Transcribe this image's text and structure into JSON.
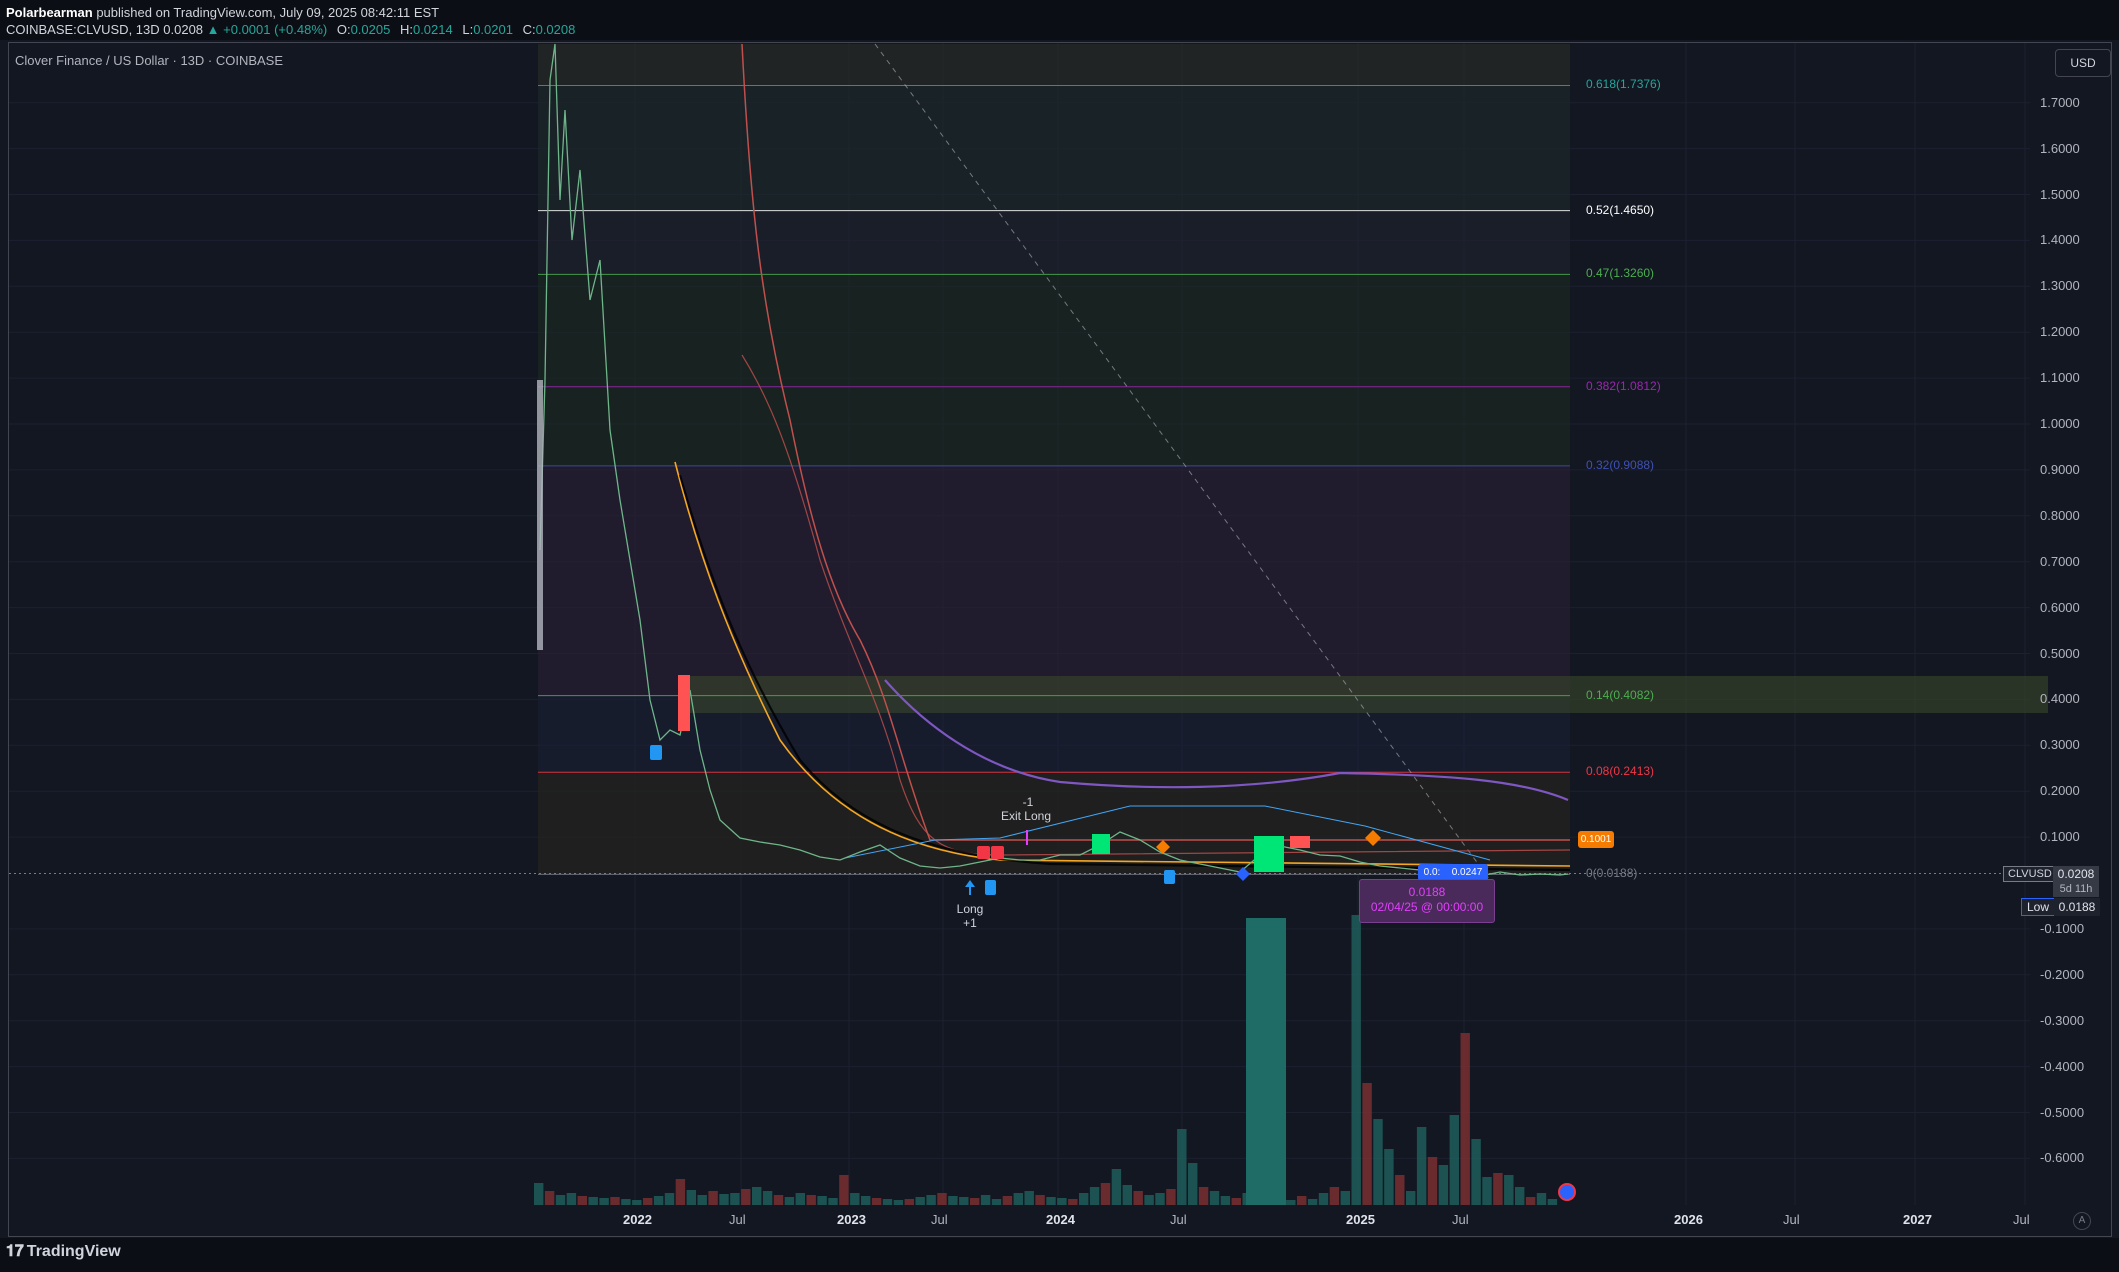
{
  "header": {
    "author": "Polarbearman",
    "publish_suffix": "published on TradingView.com, July 09, 2025 08:42:11 EST",
    "ohlc_symbol": "COINBASE:CLVUSD, 13D",
    "last": "0.0208",
    "change": "▲ +0.0001 (+0.48%)",
    "o_key": "O:",
    "o_val": "0.0205",
    "h_key": "H:",
    "h_val": "0.0214",
    "l_key": "L:",
    "l_val": "0.0201",
    "c_key": "C:",
    "c_val": "0.0208"
  },
  "chart": {
    "title": "Clover Finance / US Dollar · 13D · COINBASE",
    "currency_button": "USD",
    "y_ticks": [
      "1.7000",
      "1.6000",
      "1.5000",
      "1.4000",
      "1.3000",
      "1.2000",
      "1.1000",
      "1.0000",
      "0.9000",
      "0.8000",
      "0.7000",
      "0.6000",
      "0.5000",
      "0.4000",
      "0.3000",
      "0.2000",
      "0.1000",
      "-0.1000",
      "-0.2000",
      "-0.3000",
      "-0.4000",
      "-0.5000",
      "-0.6000"
    ],
    "x_ticks": [
      {
        "label": "2022",
        "strong": true
      },
      {
        "label": "Jul",
        "strong": false
      },
      {
        "label": "2023",
        "strong": true
      },
      {
        "label": "Jul",
        "strong": false
      },
      {
        "label": "2024",
        "strong": true
      },
      {
        "label": "Jul",
        "strong": false
      },
      {
        "label": "2025",
        "strong": true
      },
      {
        "label": "Jul",
        "strong": false
      },
      {
        "label": "2026",
        "strong": true
      },
      {
        "label": "Jul",
        "strong": false
      },
      {
        "label": "2027",
        "strong": true
      },
      {
        "label": "Jul",
        "strong": false
      }
    ],
    "fib_levels": [
      {
        "label": "0.618(1.7376)",
        "color": "#26a69a"
      },
      {
        "label": "0.52(1.4650)",
        "color": "#ffffff"
      },
      {
        "label": "0.47(1.3260)",
        "color": "#4caf50"
      },
      {
        "label": "0.382(1.0812)",
        "color": "#9c27b0"
      },
      {
        "label": "0.32(0.9088)",
        "color": "#3f51b5"
      },
      {
        "label": "0.14(0.4082)",
        "color": "#4caf50"
      },
      {
        "label": "0.08(0.2413)",
        "color": "#f23645"
      },
      {
        "label": "0(0.0188)",
        "color": "#787b86"
      }
    ],
    "annotations": {
      "exit_count": "-1",
      "exit_label": "Exit Long",
      "long_label": "Long",
      "long_count": "+1"
    },
    "tags": {
      "orange_price": "0.1001",
      "blue_a": "0.0:",
      "blue_b": "0.0247",
      "symbol": "CLVUSD",
      "last_price": "0.0208",
      "countdown": "5d 11h",
      "low_label": "Low",
      "low_value": "0.0188"
    },
    "tooltip": {
      "value": "0.0188",
      "date": "02/04/25 @ 00:00:00"
    }
  },
  "footer": {
    "brand_mark": "𝟏𝟕",
    "brand": "TradingView",
    "scale_button": "A"
  },
  "colors": {
    "background": "#131722",
    "up": "#26a69a",
    "down": "#ef5350",
    "accent": "#2962ff",
    "orange": "#f57c00"
  },
  "chart_data": {
    "type": "line",
    "title": "Clover Finance / US Dollar · 13D · COINBASE",
    "xlabel": "",
    "ylabel": "",
    "ylim": [
      -0.7,
      1.8
    ],
    "y_scale": "linear",
    "grid": true,
    "x": [
      "2021-08",
      "2021-09",
      "2021-10",
      "2021-11",
      "2021-12",
      "2022-01",
      "2022-03",
      "2022-05",
      "2022-07",
      "2022-10",
      "2023-01",
      "2023-04",
      "2023-07",
      "2023-10",
      "2024-01",
      "2024-04",
      "2024-07",
      "2024-10",
      "2025-01",
      "2025-04",
      "2025-07"
    ],
    "series": [
      {
        "name": "CLVUSD",
        "values": [
          1.1,
          1.78,
          1.55,
          1.3,
          0.9,
          0.55,
          0.38,
          0.15,
          0.1,
          0.07,
          0.045,
          0.06,
          0.03,
          0.035,
          0.05,
          0.11,
          0.06,
          0.03,
          0.1,
          0.03,
          0.0208
        ]
      }
    ]
  }
}
